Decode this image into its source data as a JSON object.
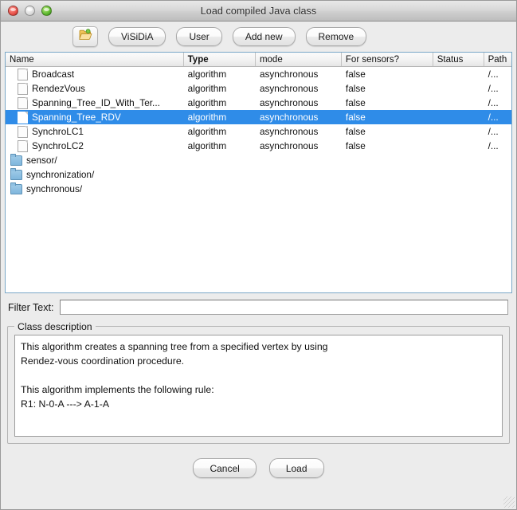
{
  "window": {
    "title": "Load compiled Java class",
    "traffic_lights": [
      "close-button",
      "minimize-button",
      "maximize-button"
    ]
  },
  "toolbar": {
    "open_icon": "open-folder-icon",
    "buttons": [
      {
        "label": "ViSiDiA",
        "name": "visidia-button"
      },
      {
        "label": "User",
        "name": "user-button"
      },
      {
        "label": "Add new",
        "name": "add-new-button"
      },
      {
        "label": "Remove",
        "name": "remove-button"
      }
    ]
  },
  "table": {
    "columns": [
      {
        "label": "Name",
        "key": "name",
        "bold": false
      },
      {
        "label": "Type",
        "key": "type",
        "bold": true
      },
      {
        "label": "mode",
        "key": "mode",
        "bold": false
      },
      {
        "label": "For sensors?",
        "key": "sensors",
        "bold": false
      },
      {
        "label": "Status",
        "key": "status",
        "bold": false
      },
      {
        "label": "Path",
        "key": "path",
        "bold": false
      }
    ],
    "rows": [
      {
        "icon": "document-icon",
        "name": "Broadcast",
        "type": "algorithm",
        "mode": "asynchronous",
        "sensors": "false",
        "status": "",
        "path": "/...",
        "selected": false
      },
      {
        "icon": "document-icon",
        "name": "RendezVous",
        "type": "algorithm",
        "mode": "asynchronous",
        "sensors": "false",
        "status": "",
        "path": "/...",
        "selected": false
      },
      {
        "icon": "document-icon",
        "name": "Spanning_Tree_ID_With_Ter...",
        "type": "algorithm",
        "mode": "asynchronous",
        "sensors": "false",
        "status": "",
        "path": "/...",
        "selected": false
      },
      {
        "icon": "document-icon",
        "name": "Spanning_Tree_RDV",
        "type": "algorithm",
        "mode": "asynchronous",
        "sensors": "false",
        "status": "",
        "path": "/...",
        "selected": true
      },
      {
        "icon": "document-icon",
        "name": "SynchroLC1",
        "type": "algorithm",
        "mode": "asynchronous",
        "sensors": "false",
        "status": "",
        "path": "/...",
        "selected": false
      },
      {
        "icon": "document-icon",
        "name": "SynchroLC2",
        "type": "algorithm",
        "mode": "asynchronous",
        "sensors": "false",
        "status": "",
        "path": "/...",
        "selected": false
      },
      {
        "icon": "folder-icon",
        "name": "sensor/",
        "type": "",
        "mode": "",
        "sensors": "",
        "status": "",
        "path": "",
        "selected": false
      },
      {
        "icon": "folder-icon",
        "name": "synchronization/",
        "type": "",
        "mode": "",
        "sensors": "",
        "status": "",
        "path": "",
        "selected": false
      },
      {
        "icon": "folder-icon",
        "name": "synchronous/",
        "type": "",
        "mode": "",
        "sensors": "",
        "status": "",
        "path": "",
        "selected": false
      }
    ],
    "selection_color": "#2f8ce8",
    "border_color": "#7aa7c7"
  },
  "filter": {
    "label": "Filter Text:",
    "value": "",
    "placeholder": ""
  },
  "class_description": {
    "title": "Class description",
    "text": "This algorithm creates a spanning tree from a specified vertex by using\nRendez-vous coordination procedure.\n\nThis algorithm implements the following rule:\nR1: N-0-A ---> A-1-A"
  },
  "footer": {
    "cancel_label": "Cancel",
    "load_label": "Load"
  }
}
